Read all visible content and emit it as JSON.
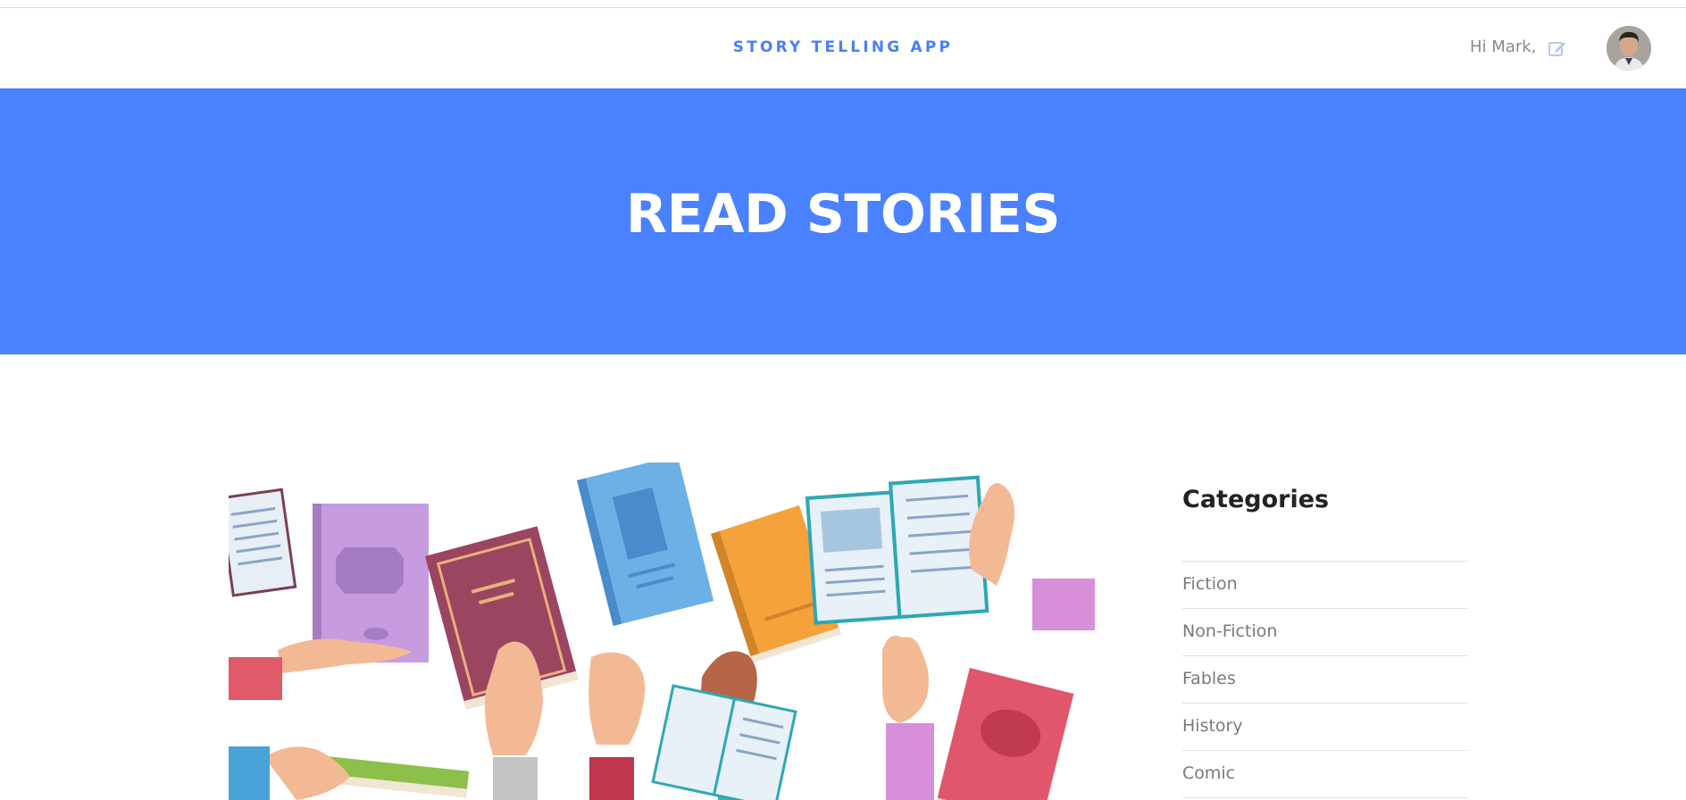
{
  "header": {
    "app_title": "STORY TELLING APP",
    "greeting": "Hi Mark,",
    "edit_icon": "edit-icon",
    "avatar": "user-avatar"
  },
  "hero": {
    "title": "READ STORIES",
    "background_color": "#4a81fe"
  },
  "sidebar": {
    "title": "Categories",
    "categories": [
      {
        "label": "Fiction"
      },
      {
        "label": "Non-Fiction"
      },
      {
        "label": "Fables"
      },
      {
        "label": "History"
      },
      {
        "label": "Comic"
      }
    ]
  },
  "colors": {
    "accent": "#4a7ff7",
    "hero_bg": "#4a81fe",
    "text_muted": "#7a7a7a",
    "heading": "#222222"
  }
}
